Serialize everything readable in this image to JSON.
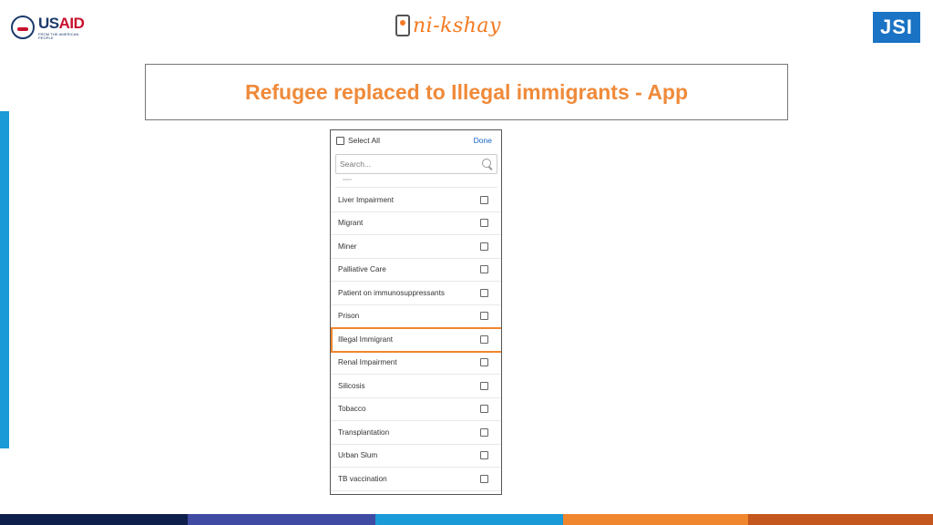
{
  "header": {
    "usaid_logo": {
      "text": "USAID",
      "tagline": "FROM THE AMERICAN PEOPLE"
    },
    "nikshay_logo": {
      "text": "ni-kshay"
    },
    "jsi_logo": {
      "text": "JSI"
    }
  },
  "slide": {
    "title": "Refugee replaced to Illegal immigrants - App"
  },
  "app": {
    "select_all_label": "Select All",
    "done_label": "Done",
    "search_placeholder": "Search...",
    "items": [
      {
        "label": "Liver Impairment",
        "checked": false
      },
      {
        "label": "Migrant",
        "checked": false
      },
      {
        "label": "Miner",
        "checked": false
      },
      {
        "label": "Palliative Care",
        "checked": false
      },
      {
        "label": "Patient on immunosuppressants",
        "checked": false
      },
      {
        "label": "Prison",
        "checked": false
      },
      {
        "label": "Illegal Immigrant",
        "checked": false,
        "highlighted": true
      },
      {
        "label": "Renal Impairment",
        "checked": false
      },
      {
        "label": "Silicosis",
        "checked": false
      },
      {
        "label": "Tobacco",
        "checked": false
      },
      {
        "label": "Transplantation",
        "checked": false
      },
      {
        "label": "Urban Slum",
        "checked": false
      },
      {
        "label": "TB vaccination",
        "checked": false
      }
    ]
  },
  "colors": {
    "title": "#ef8a3a",
    "highlight": "#f0862d",
    "accent_blue": "#1a9ad6",
    "done_link": "#1565c0"
  }
}
